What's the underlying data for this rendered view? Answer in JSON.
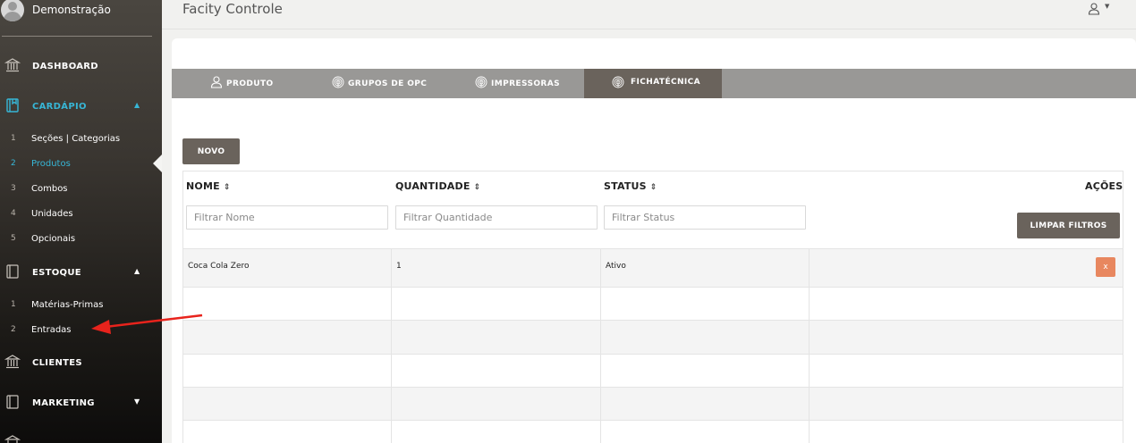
{
  "sidebar": {
    "profile_name": "Demonstração",
    "menu": [
      {
        "label": "DASHBOARD",
        "icon": "bank-icon"
      },
      {
        "label": "CARDÁPIO",
        "icon": "book-icon",
        "caret": "▲"
      },
      {
        "label": "ESTOQUE",
        "icon": "book-icon",
        "caret": "▲"
      },
      {
        "label": "CLIENTES",
        "icon": "bank-icon"
      },
      {
        "label": "MARKETING",
        "icon": "book-icon",
        "caret": "▼"
      }
    ],
    "cardapio_items": [
      {
        "num": "1",
        "label": "Seções | Categorias"
      },
      {
        "num": "2",
        "label": "Produtos"
      },
      {
        "num": "3",
        "label": "Combos"
      },
      {
        "num": "4",
        "label": "Unidades"
      },
      {
        "num": "5",
        "label": "Opcionais"
      }
    ],
    "estoque_items": [
      {
        "num": "1",
        "label": "Matérias-Primas"
      },
      {
        "num": "2",
        "label": "Entradas"
      }
    ],
    "accent_color": "#37b6d6"
  },
  "header": {
    "title": "Facity Controle",
    "user_caret": "▼"
  },
  "tabs": [
    {
      "label": "PRODUTO",
      "icon": "user-icon"
    },
    {
      "label": "GRUPOS DE OPC",
      "icon": "fingerprint-icon"
    },
    {
      "label": "IMPRESSORAS",
      "icon": "fingerprint-icon"
    },
    {
      "label": "FICHATÉCNICA",
      "icon": "fingerprint-icon",
      "active": true
    }
  ],
  "toolbar": {
    "new_label": "NOVO"
  },
  "table": {
    "columns": [
      {
        "label": "NOME",
        "sort": "⇕"
      },
      {
        "label": "QUANTIDADE",
        "sort": "⇕"
      },
      {
        "label": "STATUS",
        "sort": "⇕"
      },
      {
        "label": "AÇÕES"
      }
    ],
    "filters": {
      "nome_placeholder": "Filtrar Nome",
      "quantidade_placeholder": "Filtrar Quantidade",
      "status_placeholder": "Filtrar Status"
    },
    "clear_filters_label": "LIMPAR FILTROS",
    "rows": [
      {
        "nome": "Coca Cola Zero",
        "quantidade": "1",
        "status": "Ativo",
        "delete_label": "x"
      }
    ]
  },
  "colors": {
    "tab_bar": "#999896",
    "tab_active": "#6a635c",
    "button": "#6a635c",
    "delete_button": "#e8875f",
    "annotation_arrow": "#e8231c"
  }
}
